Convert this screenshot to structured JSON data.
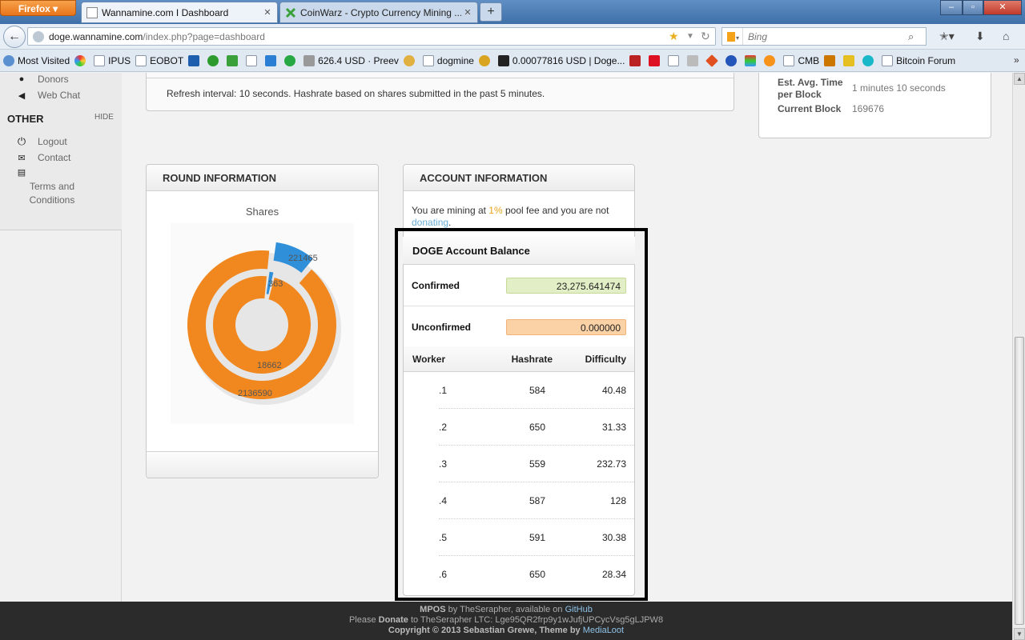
{
  "browser": {
    "app_button": "Firefox",
    "tabs": [
      {
        "label": "Wannamine.com I Dashboard",
        "active": true
      },
      {
        "label": "CoinWarz - Crypto Currency Mining ...",
        "active": false
      }
    ],
    "new_tab": "+",
    "url_host": "doge.wannamine.com",
    "url_path": "/index.php?page=dashboard",
    "search_placeholder": "Bing",
    "window_controls": [
      "–",
      "▫",
      "✕"
    ]
  },
  "bookmarks": [
    {
      "label": "Most Visited",
      "icon": "globe-icon"
    },
    {
      "label": "",
      "icon": "colorful-star-icon"
    },
    {
      "label": "IPUS",
      "icon": "blank-page-icon"
    },
    {
      "label": "EOBOT",
      "icon": "blank-page-icon"
    },
    {
      "label": "",
      "icon": "paypal-icon"
    },
    {
      "label": "",
      "icon": "green-circle-icon"
    },
    {
      "label": "",
      "icon": "green-x-icon"
    },
    {
      "label": "",
      "icon": "blank-page-icon"
    },
    {
      "label": "",
      "icon": "blue-c-icon"
    },
    {
      "label": "",
      "icon": "green-refresh-icon"
    },
    {
      "label": "626.4 USD · Preev",
      "icon": "bitcoin-b-icon"
    },
    {
      "label": "",
      "icon": "doge-face-icon"
    },
    {
      "label": "dogmine",
      "icon": "blank-page-icon"
    },
    {
      "label": "",
      "icon": "gold-coin-icon"
    },
    {
      "label": "0.00077816 USD | Doge...",
      "icon": "doge-d-icon"
    },
    {
      "label": "",
      "icon": "cm-icon"
    },
    {
      "label": "",
      "icon": "red-s-icon"
    },
    {
      "label": "",
      "icon": "blank-page-icon"
    },
    {
      "label": "",
      "icon": "grey-page-icon"
    },
    {
      "label": "",
      "icon": "diamond-icon"
    },
    {
      "label": "",
      "icon": "moon-icon"
    },
    {
      "label": "",
      "icon": "multicolor-icon"
    },
    {
      "label": "",
      "icon": "bitcoin-coin-icon"
    },
    {
      "label": "CMB",
      "icon": "blank-page-icon"
    },
    {
      "label": "",
      "icon": "b1-icon"
    },
    {
      "label": "",
      "icon": "shield-icon"
    },
    {
      "label": "",
      "icon": "cyan-c-icon"
    },
    {
      "label": "Bitcoin Forum",
      "icon": "blank-page-icon"
    }
  ],
  "sidebar": {
    "top_items": [
      {
        "label": "Donors",
        "icon": "money-bag-icon"
      },
      {
        "label": "Web Chat",
        "icon": "megaphone-icon"
      }
    ],
    "section_title": "OTHER",
    "hide_label": "HIDE",
    "other_items": [
      {
        "label": "Logout",
        "icon": "power-icon"
      },
      {
        "label": "Contact",
        "icon": "envelope-icon"
      },
      {
        "label": "Terms and Conditions",
        "icon": "document-icon"
      }
    ]
  },
  "refresh_text": "Refresh interval: 10 seconds. Hashrate based on shares submitted in the past 5 minutes.",
  "pool_stats": [
    {
      "label": "Est. Avg. Time per Block",
      "value": "1 minutes 10 seconds"
    },
    {
      "label": "Current Block",
      "value": "169676"
    }
  ],
  "round_info": {
    "title": "ROUND INFORMATION"
  },
  "chart_data": {
    "type": "pie",
    "title": "Shares",
    "rings": [
      {
        "name": "outer",
        "slices": [
          {
            "label": "2136590",
            "value": 2136590,
            "color": "#f0881f"
          },
          {
            "label": "221465",
            "value": 221465,
            "color": "#2f8fd8"
          }
        ]
      },
      {
        "name": "inner",
        "slices": [
          {
            "label": "18662",
            "value": 18662,
            "color": "#f0881f"
          },
          {
            "label": "363",
            "value": 363,
            "color": "#2f8fd8"
          }
        ]
      }
    ]
  },
  "account": {
    "title": "ACCOUNT INFORMATION",
    "fee_prefix": "You are mining at ",
    "fee_pct": "1%",
    "fee_middle": " pool fee and you are not ",
    "donating_link": "donating",
    "fee_suffix": ".",
    "balance_title": "DOGE Account Balance",
    "confirmed_label": "Confirmed",
    "confirmed_value": "23,275.641474",
    "unconfirmed_label": "Unconfirmed",
    "unconfirmed_value": "0.000000",
    "worker_headers": {
      "worker": "Worker",
      "hashrate": "Hashrate",
      "difficulty": "Difficulty"
    },
    "workers": [
      {
        "name": ".1",
        "hashrate": "584",
        "difficulty": "40.48"
      },
      {
        "name": ".2",
        "hashrate": "650",
        "difficulty": "31.33"
      },
      {
        "name": ".3",
        "hashrate": "559",
        "difficulty": "232.73"
      },
      {
        "name": ".4",
        "hashrate": "587",
        "difficulty": "128"
      },
      {
        "name": ".5",
        "hashrate": "591",
        "difficulty": "30.38"
      },
      {
        "name": ".6",
        "hashrate": "650",
        "difficulty": "28.34"
      }
    ]
  },
  "footer": {
    "line1_brand": "MPOS",
    "line1_text": " by TheSerapher, available on ",
    "line1_link": "GitHub",
    "line2_pre": "Please ",
    "line2_bold": "Donate",
    "line2_text": " to TheSerapher LTC: Lge95QR2frp9y1wJufjUPCycVsg5gLJPW8",
    "line3_text": "Copyright © 2013 Sebastian Grewe, Theme by ",
    "line3_link": "MediaLoot"
  },
  "colors": {
    "accent_orange": "#f0881f",
    "accent_blue": "#2f8fd8",
    "link": "#6aaed6"
  }
}
